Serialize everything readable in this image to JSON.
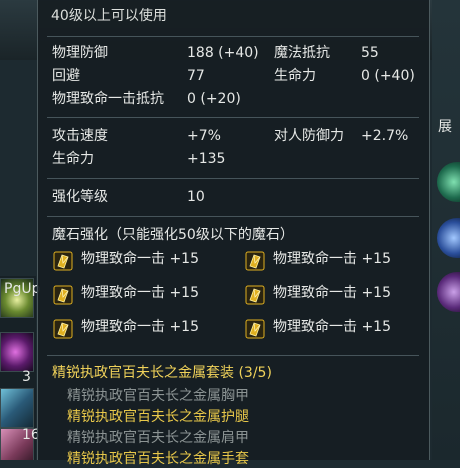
{
  "background": {
    "left_slot_label": "PgUp",
    "left_slot_count_1": "3",
    "left_slot_count_2": "16",
    "right_panel_tab": "展"
  },
  "item": {
    "level_restriction": "40级以上可以使用",
    "base_stats": [
      {
        "label": "物理防御",
        "value": "188 (+40)",
        "label2": "魔法抵抗",
        "value2": "55"
      },
      {
        "label": "回避",
        "value": "77",
        "label2": "生命力",
        "value2": "0 (+40)"
      },
      {
        "label": "物理致命一击抵抗",
        "value": "0 (+20)"
      }
    ],
    "bonus_stats": [
      {
        "label": "攻击速度",
        "value": "+7%",
        "label2": "对人防御力",
        "value2": "+2.7%"
      },
      {
        "label": "生命力",
        "value": "+135"
      }
    ],
    "enchant": {
      "label": "强化等级",
      "value": "10"
    },
    "manastone": {
      "title": "魔石强化（只能强化50级以下的魔石）",
      "slots": [
        {
          "text": "物理致命一击 +15"
        },
        {
          "text": "物理致命一击 +15"
        },
        {
          "text": "物理致命一击 +15"
        },
        {
          "text": "物理致命一击 +15"
        },
        {
          "text": "物理致命一击 +15"
        },
        {
          "text": "物理致命一击 +15"
        }
      ],
      "icon": "manastone-icon",
      "icon_color": "#e0b020"
    },
    "set": {
      "title": "精锐执政官百夫长之金属套装 (3/5)",
      "title_color": "#f0d25a",
      "pieces": [
        {
          "name": "精锐执政官百夫长之金属胸甲",
          "equipped": false
        },
        {
          "name": "精锐执政官百夫长之金属护腿",
          "equipped": true
        },
        {
          "name": "精锐执政官百夫长之金属肩甲",
          "equipped": false
        },
        {
          "name": "精锐执政官百夫长之金属手套",
          "equipped": true
        }
      ]
    }
  }
}
